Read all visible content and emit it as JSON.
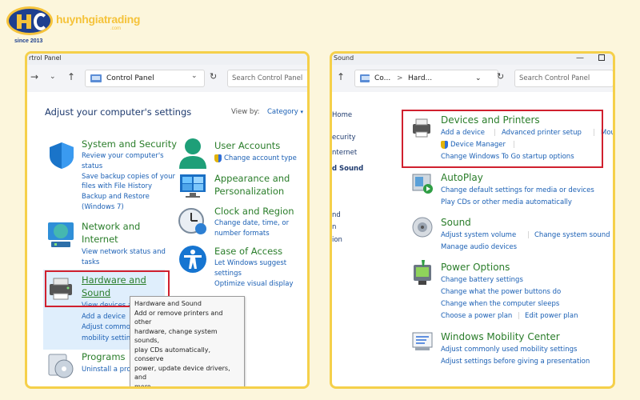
{
  "brand": {
    "name": "huynhgiatrading",
    "domain_suffix": ".com",
    "since": "since 2013",
    "colors": {
      "accent": "#f5c33b",
      "primary": "#1d3f8f"
    }
  },
  "left": {
    "title_fragment": "rtrol Panel",
    "address": "Control Panel",
    "search_placeholder": "Search Control Panel",
    "heading": "Adjust your computer's settings",
    "view_by_label": "View by:",
    "view_by_value": "Category",
    "categories": {
      "system": {
        "title": "System and Security",
        "links": [
          "Review your computer's",
          "status",
          "Save backup copies of your",
          "files with File History",
          "Backup and Restore",
          "(Windows 7)"
        ]
      },
      "network": {
        "title": [
          "Network and",
          "Internet"
        ],
        "links": [
          "View network status and",
          "tasks"
        ]
      },
      "hardware": {
        "title": [
          "Hardware and",
          "Sound"
        ],
        "links": [
          "View devices a",
          "Add a device",
          "Adjust commo",
          "mobility settin"
        ]
      },
      "programs": {
        "title": "Programs",
        "links": [
          "Uninstall a program"
        ]
      },
      "user": {
        "title": "User Accounts",
        "links": [
          "Change account type"
        ]
      },
      "appearance": {
        "title": [
          "Appearance and",
          "Personalization"
        ]
      },
      "clock": {
        "title": "Clock and Region",
        "links": [
          "Change date, time, or",
          "number formats"
        ]
      },
      "ease": {
        "title": "Ease of Access",
        "links": [
          "Let Windows suggest",
          "settings",
          "Optimize visual display"
        ]
      }
    },
    "tooltip": [
      "Hardware and Sound",
      "Add or remove printers and other",
      "hardware, change system sounds,",
      "play CDs automatically, conserve",
      "power, update device drivers, and",
      "more."
    ]
  },
  "right": {
    "title_fragment": "Sound",
    "address_parts": [
      "Co...",
      ">",
      "Hard..."
    ],
    "search_placeholder": "Search Control Panel",
    "sidebar": [
      "Home",
      "ecurity",
      "nternet",
      "d Sound",
      "nd",
      "n",
      "ion"
    ],
    "sections": {
      "devices": {
        "title": "Devices and Printers",
        "links": [
          "Add a device",
          "Advanced printer setup",
          "Mou",
          "Device Manager",
          "Change Windows To Go startup options"
        ]
      },
      "autoplay": {
        "title": "AutoPlay",
        "links": [
          "Change default settings for media or devices",
          "Play CDs or other media automatically"
        ]
      },
      "sound": {
        "title": "Sound",
        "links": [
          "Adjust system volume",
          "Change system sound",
          "Manage audio devices"
        ]
      },
      "power": {
        "title": "Power Options",
        "links": [
          "Change battery settings",
          "Change what the power buttons do",
          "Change when the computer sleeps",
          "Choose a power plan",
          "Edit power plan"
        ]
      },
      "mobility": {
        "title": "Windows Mobility Center",
        "links": [
          "Adjust commonly used mobility settings",
          "Adjust settings before giving a presentation"
        ]
      }
    }
  }
}
